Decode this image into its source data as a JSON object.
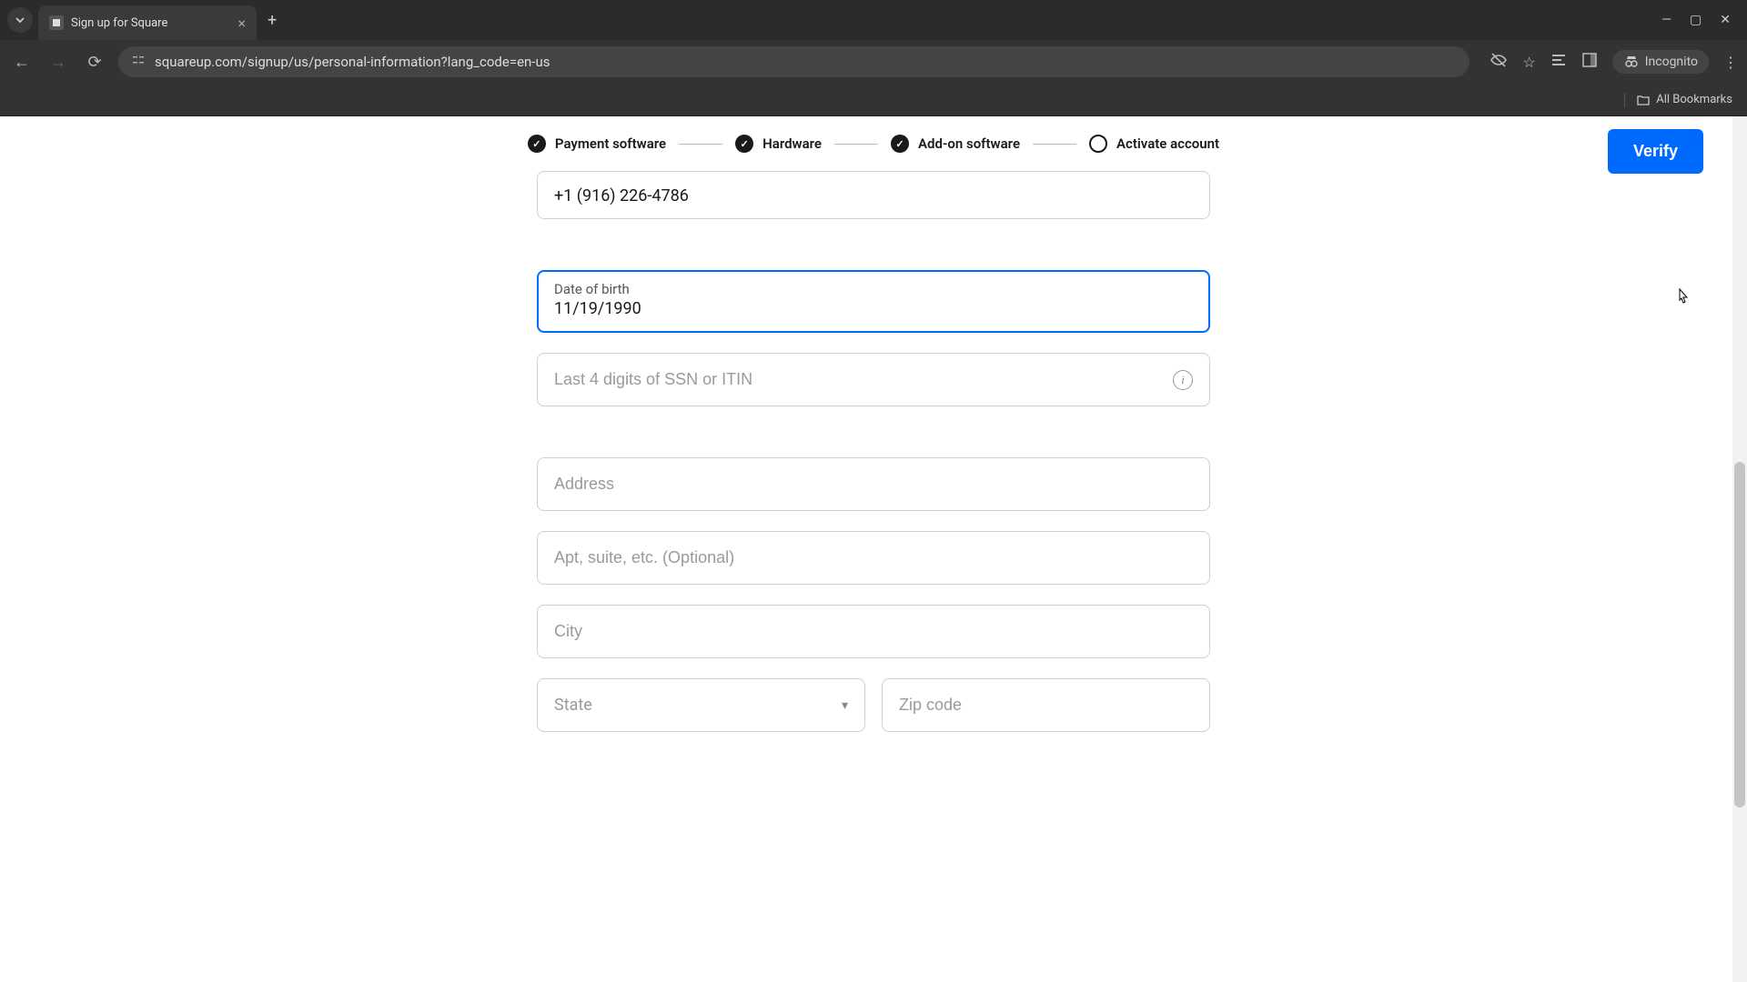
{
  "browser": {
    "tab_title": "Sign up for Square",
    "url": "squareup.com/signup/us/personal-information?lang_code=en-us",
    "incognito_label": "Incognito",
    "all_bookmarks": "All Bookmarks"
  },
  "stepper": {
    "steps": [
      {
        "label": "Payment software",
        "state": "done"
      },
      {
        "label": "Hardware",
        "state": "done"
      },
      {
        "label": "Add-on software",
        "state": "done"
      },
      {
        "label": "Activate account",
        "state": "pending"
      }
    ]
  },
  "verify_button": "Verify",
  "form": {
    "phone_value": "+1 (916) 226-4786",
    "dob_label": "Date of birth",
    "dob_value": "11/19/1990",
    "ssn_placeholder": "Last 4 digits of SSN or ITIN",
    "address_placeholder": "Address",
    "apt_placeholder": "Apt, suite, etc. (Optional)",
    "city_placeholder": "City",
    "state_placeholder": "State",
    "zip_placeholder": "Zip code"
  }
}
